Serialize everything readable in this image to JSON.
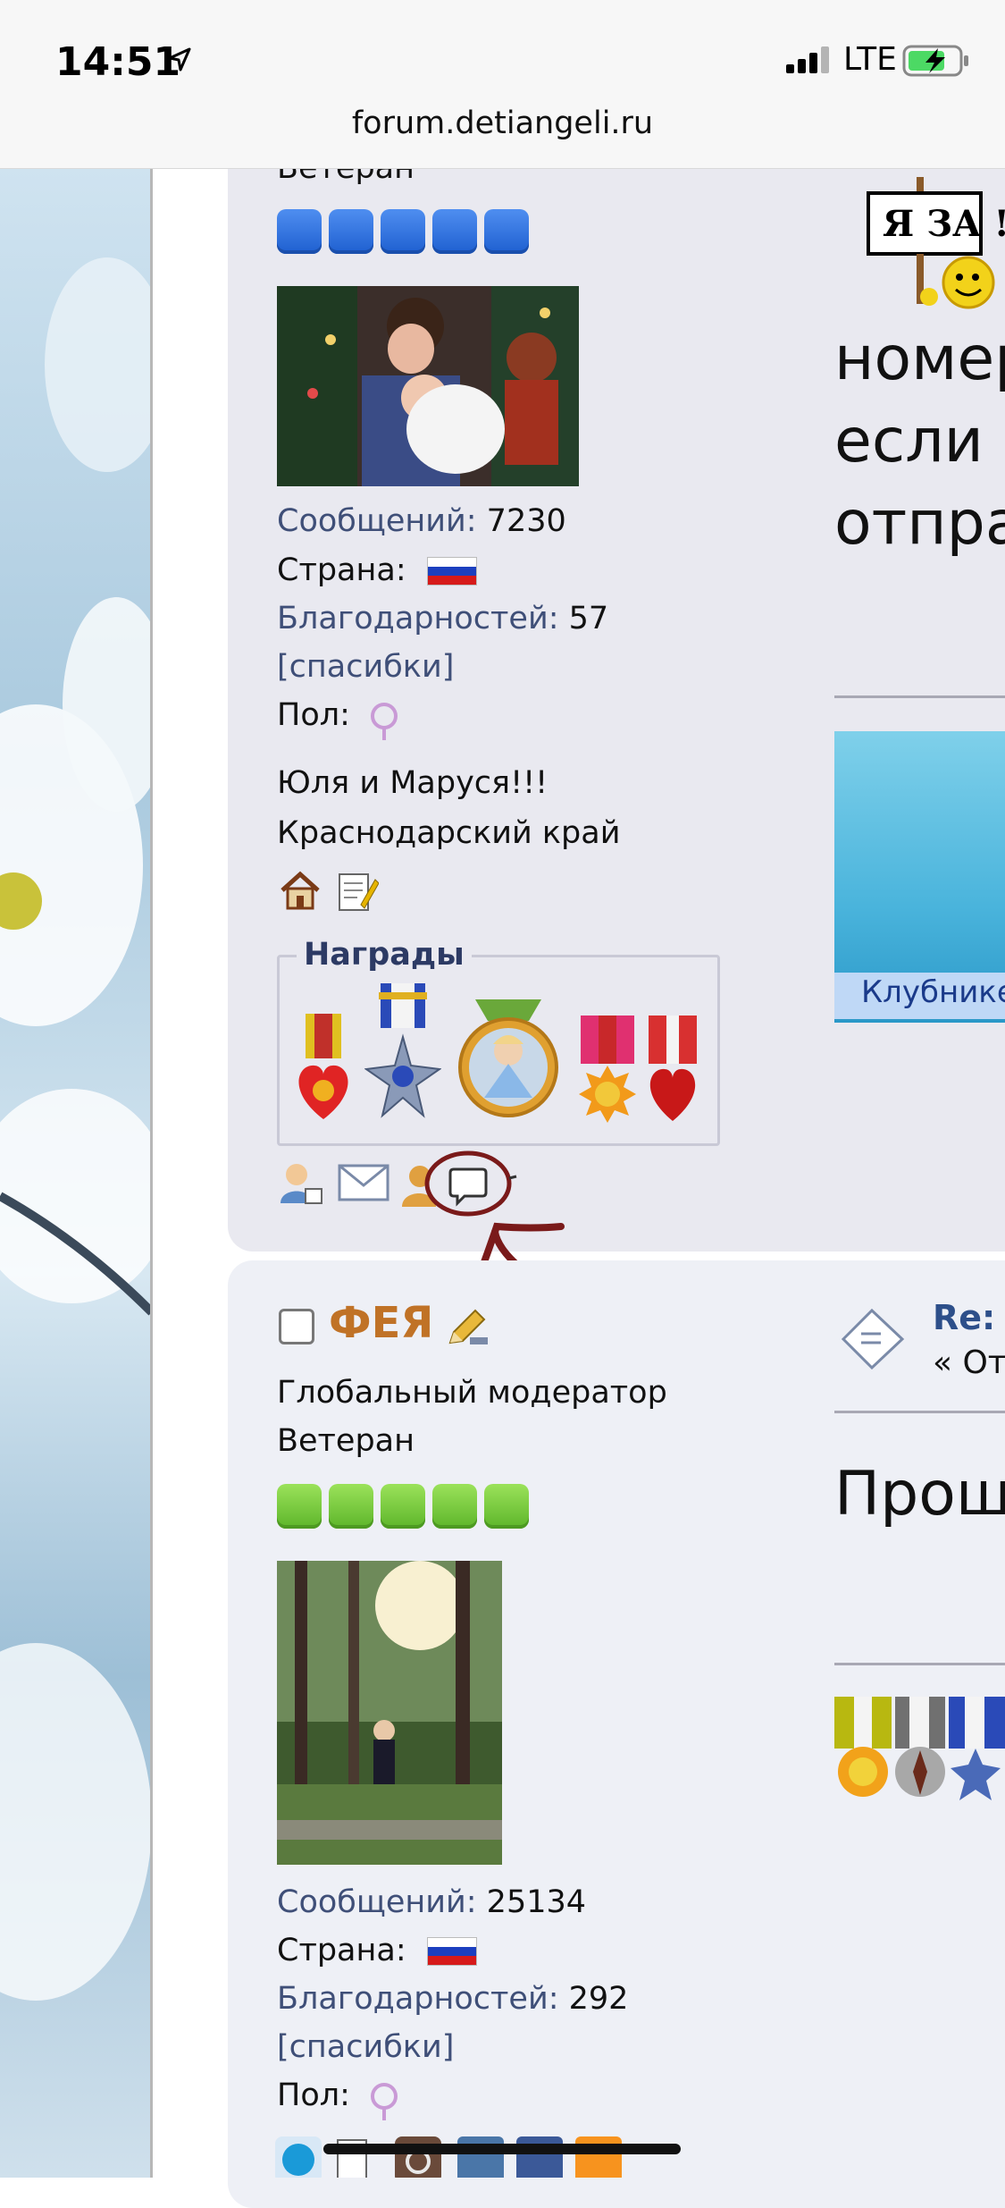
{
  "status": {
    "time": "14:51",
    "network": "LTE",
    "url": "forum.detiangeli.ru"
  },
  "post1": {
    "rank_partial": "Ветеран",
    "messages_label": "Сообщений:",
    "messages_value": "7230",
    "country_label": "Страна:",
    "thanks_label": "Благодарностей:",
    "thanks_value": "57",
    "thanks_link": "[спасибки]",
    "gender_label": "Пол:",
    "signature_line1": "Юля и Маруся!!!",
    "signature_line2": "Краснодарский край",
    "awards_title": "Награды",
    "sign_text": "Я ЗА !",
    "text_line1": "номер",
    "text_line2": "если",
    "text_line3": "отпра",
    "banner_text": "Клубнике"
  },
  "post2": {
    "username": "ФЕЯ",
    "role": "Глобальный модератор",
    "rank": "Ветеран",
    "messages_label": "Сообщений:",
    "messages_value": "25134",
    "country_label": "Страна:",
    "thanks_label": "Благодарностей:",
    "thanks_value": "292",
    "thanks_link": "[спасибки]",
    "gender_label": "Пол:",
    "re_label": "Re:",
    "re_sub": "« От",
    "text_line1": "Прощ"
  },
  "colors": {
    "username": "#c07226",
    "label": "#3f4f78",
    "rank_blue": "#2b6fe0",
    "rank_green": "#74c83a"
  }
}
